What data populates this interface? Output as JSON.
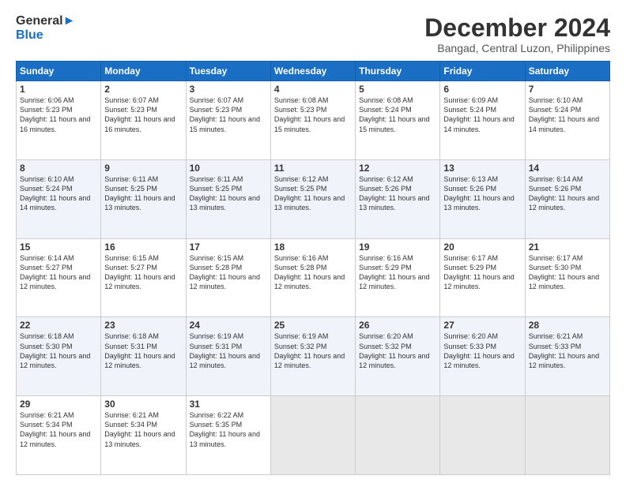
{
  "header": {
    "logo_line1": "General",
    "logo_line2": "Blue",
    "title": "December 2024",
    "subtitle": "Bangad, Central Luzon, Philippines"
  },
  "calendar": {
    "days_of_week": [
      "Sunday",
      "Monday",
      "Tuesday",
      "Wednesday",
      "Thursday",
      "Friday",
      "Saturday"
    ],
    "weeks": [
      [
        {
          "day": 1,
          "sunrise": "6:06 AM",
          "sunset": "5:23 PM",
          "daylight": "11 hours and 16 minutes."
        },
        {
          "day": 2,
          "sunrise": "6:07 AM",
          "sunset": "5:23 PM",
          "daylight": "11 hours and 16 minutes."
        },
        {
          "day": 3,
          "sunrise": "6:07 AM",
          "sunset": "5:23 PM",
          "daylight": "11 hours and 15 minutes."
        },
        {
          "day": 4,
          "sunrise": "6:08 AM",
          "sunset": "5:23 PM",
          "daylight": "11 hours and 15 minutes."
        },
        {
          "day": 5,
          "sunrise": "6:08 AM",
          "sunset": "5:24 PM",
          "daylight": "11 hours and 15 minutes."
        },
        {
          "day": 6,
          "sunrise": "6:09 AM",
          "sunset": "5:24 PM",
          "daylight": "11 hours and 14 minutes."
        },
        {
          "day": 7,
          "sunrise": "6:10 AM",
          "sunset": "5:24 PM",
          "daylight": "11 hours and 14 minutes."
        }
      ],
      [
        {
          "day": 8,
          "sunrise": "6:10 AM",
          "sunset": "5:24 PM",
          "daylight": "11 hours and 14 minutes."
        },
        {
          "day": 9,
          "sunrise": "6:11 AM",
          "sunset": "5:25 PM",
          "daylight": "11 hours and 13 minutes."
        },
        {
          "day": 10,
          "sunrise": "6:11 AM",
          "sunset": "5:25 PM",
          "daylight": "11 hours and 13 minutes."
        },
        {
          "day": 11,
          "sunrise": "6:12 AM",
          "sunset": "5:25 PM",
          "daylight": "11 hours and 13 minutes."
        },
        {
          "day": 12,
          "sunrise": "6:12 AM",
          "sunset": "5:26 PM",
          "daylight": "11 hours and 13 minutes."
        },
        {
          "day": 13,
          "sunrise": "6:13 AM",
          "sunset": "5:26 PM",
          "daylight": "11 hours and 13 minutes."
        },
        {
          "day": 14,
          "sunrise": "6:14 AM",
          "sunset": "5:26 PM",
          "daylight": "11 hours and 12 minutes."
        }
      ],
      [
        {
          "day": 15,
          "sunrise": "6:14 AM",
          "sunset": "5:27 PM",
          "daylight": "11 hours and 12 minutes."
        },
        {
          "day": 16,
          "sunrise": "6:15 AM",
          "sunset": "5:27 PM",
          "daylight": "11 hours and 12 minutes."
        },
        {
          "day": 17,
          "sunrise": "6:15 AM",
          "sunset": "5:28 PM",
          "daylight": "11 hours and 12 minutes."
        },
        {
          "day": 18,
          "sunrise": "6:16 AM",
          "sunset": "5:28 PM",
          "daylight": "11 hours and 12 minutes."
        },
        {
          "day": 19,
          "sunrise": "6:16 AM",
          "sunset": "5:29 PM",
          "daylight": "11 hours and 12 minutes."
        },
        {
          "day": 20,
          "sunrise": "6:17 AM",
          "sunset": "5:29 PM",
          "daylight": "11 hours and 12 minutes."
        },
        {
          "day": 21,
          "sunrise": "6:17 AM",
          "sunset": "5:30 PM",
          "daylight": "11 hours and 12 minutes."
        }
      ],
      [
        {
          "day": 22,
          "sunrise": "6:18 AM",
          "sunset": "5:30 PM",
          "daylight": "11 hours and 12 minutes."
        },
        {
          "day": 23,
          "sunrise": "6:18 AM",
          "sunset": "5:31 PM",
          "daylight": "11 hours and 12 minutes."
        },
        {
          "day": 24,
          "sunrise": "6:19 AM",
          "sunset": "5:31 PM",
          "daylight": "11 hours and 12 minutes."
        },
        {
          "day": 25,
          "sunrise": "6:19 AM",
          "sunset": "5:32 PM",
          "daylight": "11 hours and 12 minutes."
        },
        {
          "day": 26,
          "sunrise": "6:20 AM",
          "sunset": "5:32 PM",
          "daylight": "11 hours and 12 minutes."
        },
        {
          "day": 27,
          "sunrise": "6:20 AM",
          "sunset": "5:33 PM",
          "daylight": "11 hours and 12 minutes."
        },
        {
          "day": 28,
          "sunrise": "6:21 AM",
          "sunset": "5:33 PM",
          "daylight": "11 hours and 12 minutes."
        }
      ],
      [
        {
          "day": 29,
          "sunrise": "6:21 AM",
          "sunset": "5:34 PM",
          "daylight": "11 hours and 12 minutes."
        },
        {
          "day": 30,
          "sunrise": "6:21 AM",
          "sunset": "5:34 PM",
          "daylight": "11 hours and 13 minutes."
        },
        {
          "day": 31,
          "sunrise": "6:22 AM",
          "sunset": "5:35 PM",
          "daylight": "11 hours and 13 minutes."
        },
        null,
        null,
        null,
        null
      ]
    ]
  }
}
